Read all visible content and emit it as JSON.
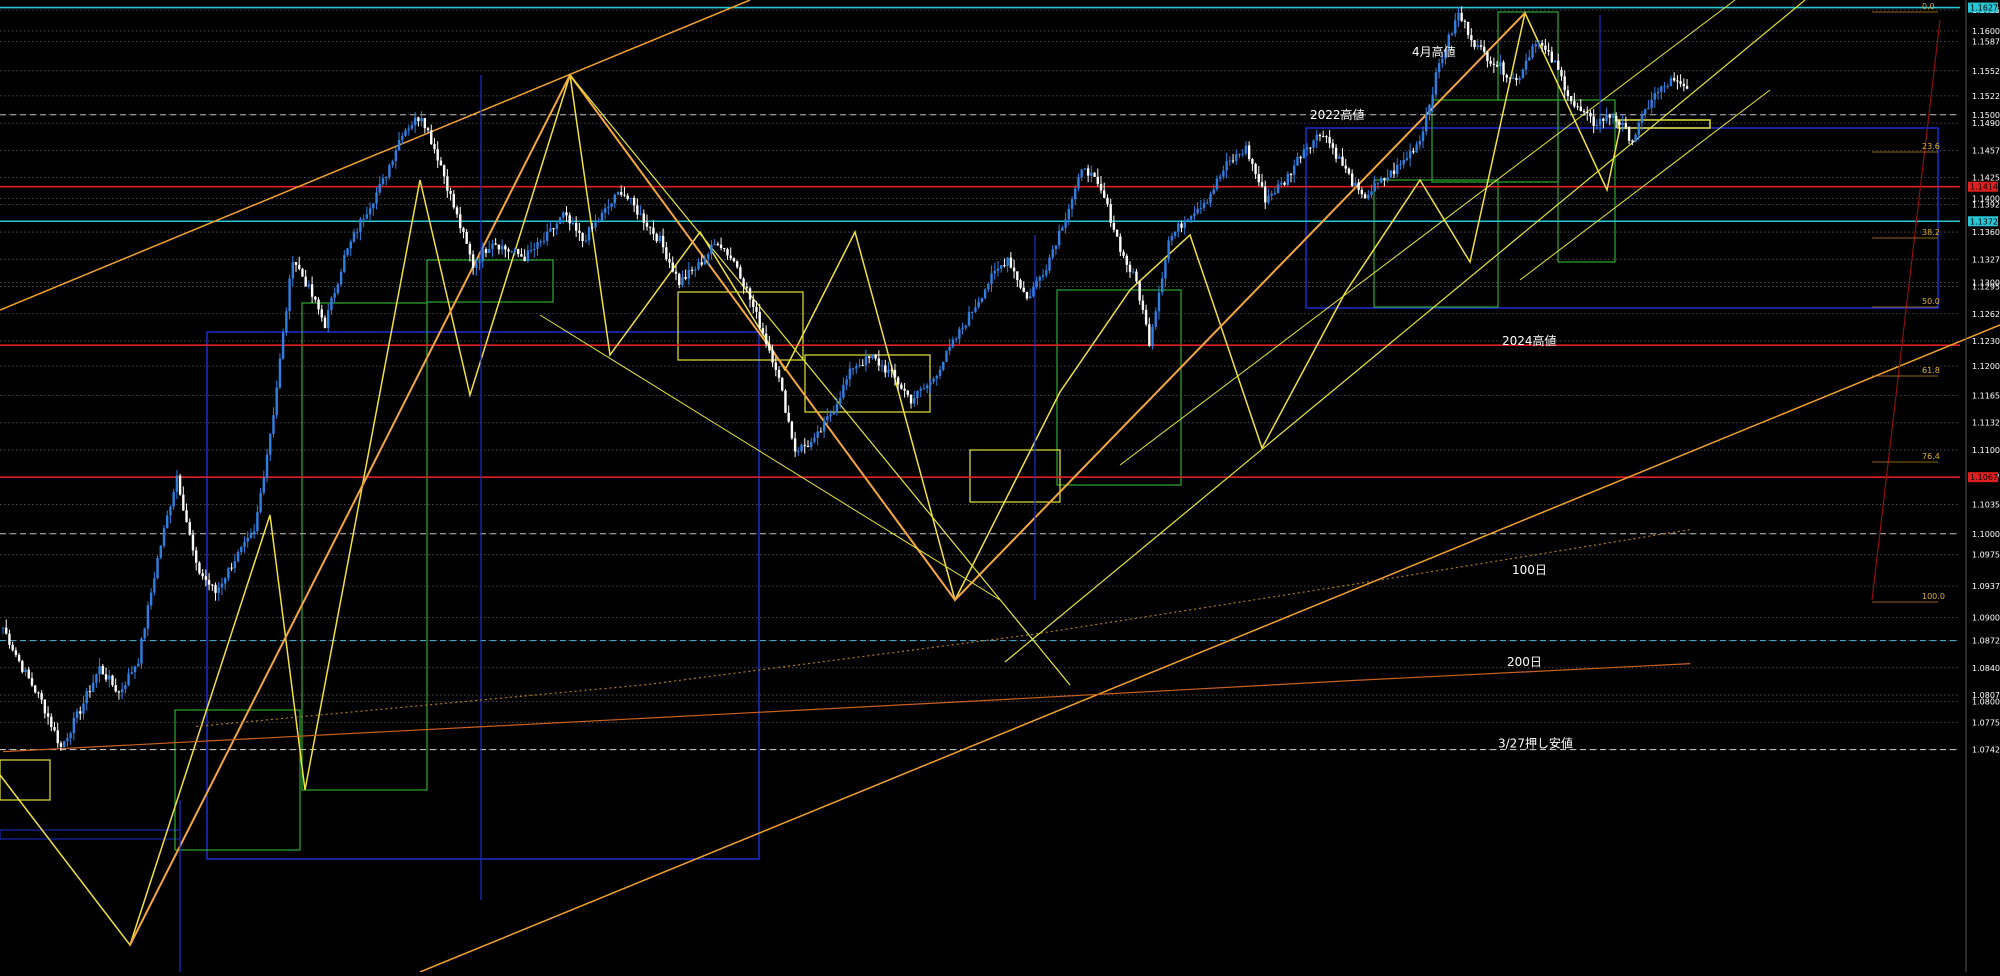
{
  "chart_data": {
    "type": "candlestick",
    "symbol_note": "EUR/USD style price chart with MA lines, fibonacci levels and trend channels",
    "y_axis": {
      "range": [
        1.0715,
        1.6236
      ],
      "ticks": [
        "1.16250",
        "1.16000",
        "1.15875",
        "1.15525",
        "1.15225",
        "1.15000",
        "1.14900",
        "1.14575",
        "1.14250",
        "1.14000",
        "1.13929",
        "1.13600",
        "1.13275",
        "1.13000",
        "1.12950",
        "1.12625",
        "1.12300",
        "1.12000",
        "1.11650",
        "1.11325",
        "1.11000",
        "1.10675",
        "1.10350",
        "1.10000",
        "1.09750",
        "1.09375",
        "1.09000",
        "1.08725",
        "1.08400",
        "1.08075",
        "1.08000",
        "1.07750",
        "1.07425"
      ],
      "highlighted_tags": [
        {
          "label": "1.16279",
          "color": "#29c6d6"
        },
        {
          "label": "1.14141",
          "color": "#e02020"
        },
        {
          "label": "1.13729",
          "color": "#29c6d6"
        },
        {
          "label": "1.10675",
          "color": "#e02020"
        }
      ]
    },
    "fib_labels": [
      "0.0",
      "23.6",
      "38.2",
      "50.0",
      "61.8",
      "76.4",
      "100.0"
    ],
    "annotations": [
      {
        "text": "4月高値",
        "price": 1.157
      },
      {
        "text": "2022高値",
        "price": 1.1495
      },
      {
        "text": "2024高値",
        "price": 1.1225
      },
      {
        "text": "100日",
        "price": 1.0952
      },
      {
        "text": "200日",
        "price": 1.0842
      },
      {
        "text": "3/27押し安値",
        "price": 1.0745
      }
    ],
    "horizontal_levels": [
      {
        "price": 1.16279,
        "color": "#29c6d6",
        "style": "solid"
      },
      {
        "price": 1.14141,
        "color": "#e02020",
        "style": "solid"
      },
      {
        "price": 1.13729,
        "color": "#29c6d6",
        "style": "solid"
      },
      {
        "price": 1.1225,
        "color": "#e02020",
        "style": "solid"
      },
      {
        "price": 1.10675,
        "color": "#e02020",
        "style": "solid"
      },
      {
        "price": 1.15,
        "color": "#c0c0c0",
        "style": "dashed"
      },
      {
        "price": 1.1,
        "color": "#c0c0c0",
        "style": "dashed"
      },
      {
        "price": 1.08725,
        "color": "#4aa0c0",
        "style": "dashed"
      },
      {
        "price": 1.07425,
        "color": "#c0c0c0",
        "style": "dashed"
      }
    ],
    "price_path": [
      [
        0,
        1.0888
      ],
      [
        6,
        1.084
      ],
      [
        12,
        1.08
      ],
      [
        18,
        1.0745
      ],
      [
        24,
        1.079
      ],
      [
        30,
        1.084
      ],
      [
        36,
        1.081
      ],
      [
        42,
        1.085
      ],
      [
        48,
        1.097
      ],
      [
        54,
        1.107
      ],
      [
        60,
        1.096
      ],
      [
        66,
        1.093
      ],
      [
        72,
        1.097
      ],
      [
        78,
        1.1
      ],
      [
        84,
        1.1145
      ],
      [
        90,
        1.133
      ],
      [
        94,
        1.13
      ],
      [
        100,
        1.125
      ],
      [
        106,
        1.133
      ],
      [
        112,
        1.138
      ],
      [
        118,
        1.142
      ],
      [
        124,
        1.148
      ],
      [
        130,
        1.15
      ],
      [
        136,
        1.144
      ],
      [
        140,
        1.139
      ],
      [
        146,
        1.132
      ],
      [
        152,
        1.135
      ],
      [
        156,
        1.134
      ],
      [
        162,
        1.133
      ],
      [
        168,
        1.135
      ],
      [
        174,
        1.138
      ],
      [
        180,
        1.135
      ],
      [
        186,
        1.138
      ],
      [
        192,
        1.141
      ],
      [
        198,
        1.138
      ],
      [
        204,
        1.135
      ],
      [
        210,
        1.13
      ],
      [
        216,
        1.132
      ],
      [
        222,
        1.135
      ],
      [
        228,
        1.132
      ],
      [
        234,
        1.126
      ],
      [
        240,
        1.12
      ],
      [
        246,
        1.11
      ],
      [
        252,
        1.111
      ],
      [
        258,
        1.115
      ],
      [
        264,
        1.12
      ],
      [
        270,
        1.121
      ],
      [
        276,
        1.119
      ],
      [
        282,
        1.116
      ],
      [
        288,
        1.118
      ],
      [
        294,
        1.122
      ],
      [
        300,
        1.126
      ],
      [
        306,
        1.13
      ],
      [
        312,
        1.133
      ],
      [
        318,
        1.128
      ],
      [
        324,
        1.132
      ],
      [
        330,
        1.138
      ],
      [
        336,
        1.144
      ],
      [
        342,
        1.14
      ],
      [
        348,
        1.133
      ],
      [
        352,
        1.13
      ],
      [
        356,
        1.123
      ],
      [
        362,
        1.135
      ],
      [
        368,
        1.138
      ],
      [
        374,
        1.14
      ],
      [
        380,
        1.144
      ],
      [
        386,
        1.146
      ],
      [
        392,
        1.14
      ],
      [
        398,
        1.142
      ],
      [
        404,
        1.146
      ],
      [
        410,
        1.148
      ],
      [
        416,
        1.144
      ],
      [
        422,
        1.14
      ],
      [
        428,
        1.142
      ],
      [
        434,
        1.144
      ],
      [
        440,
        1.147
      ],
      [
        446,
        1.156
      ],
      [
        452,
        1.162
      ],
      [
        458,
        1.158
      ],
      [
        464,
        1.156
      ],
      [
        470,
        1.154
      ],
      [
        476,
        1.159
      ],
      [
        482,
        1.156
      ],
      [
        488,
        1.151
      ],
      [
        494,
        1.149
      ],
      [
        500,
        1.15
      ],
      [
        506,
        1.147
      ],
      [
        512,
        1.152
      ],
      [
        518,
        1.154
      ],
      [
        524,
        1.1528
      ]
    ],
    "moving_averages": [
      {
        "name": "100日",
        "color": "#b07a20",
        "style": "dotted",
        "points": [
          [
            60,
            1.077
          ],
          [
            200,
            1.082
          ],
          [
            320,
            1.088
          ],
          [
            420,
            1.094
          ],
          [
            524,
            1.1005
          ]
        ]
      },
      {
        "name": "200日",
        "color": "#c86020",
        "style": "solid",
        "points": [
          [
            0,
            1.074
          ],
          [
            150,
            1.077
          ],
          [
            300,
            1.08
          ],
          [
            420,
            1.0825
          ],
          [
            524,
            1.0845
          ]
        ]
      }
    ],
    "grid": false,
    "legend": "none"
  }
}
